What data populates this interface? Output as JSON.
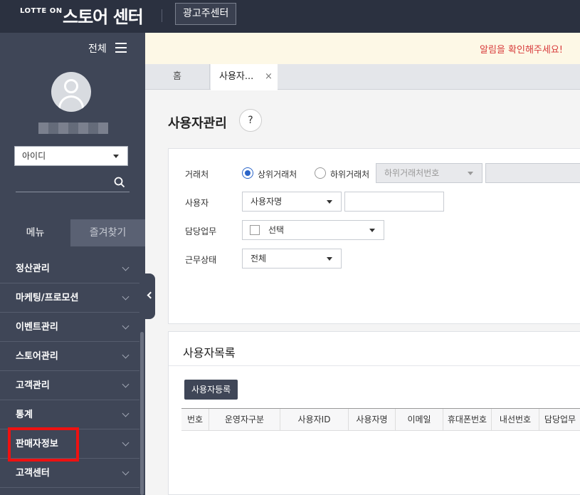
{
  "header": {
    "brand_small": "LOTTE ON",
    "brand_title": "스토어 센터",
    "ad_center_label": "광고주센터"
  },
  "sidebar": {
    "all_label": "전체",
    "id_select_value": "아이디",
    "tabs": {
      "menu": "메뉴",
      "favorites": "즐겨찾기"
    },
    "items": [
      {
        "label": "정산관리"
      },
      {
        "label": "마케팅/프로모션"
      },
      {
        "label": "이벤트관리"
      },
      {
        "label": "스토어관리"
      },
      {
        "label": "고객관리"
      },
      {
        "label": "통계"
      },
      {
        "label": "판매자정보"
      },
      {
        "label": "고객센터"
      }
    ],
    "highlight_color": "#ee1111"
  },
  "notice": {
    "text": "알림을 확인해주세요!"
  },
  "page_tabs": {
    "home": "홈",
    "current": "사용자...",
    "close": "×"
  },
  "page": {
    "title": "사용자관리",
    "help": "?"
  },
  "filters": {
    "partner_label": "거래처",
    "partner_upper": "상위거래처",
    "partner_lower": "하위거래처",
    "partner_lower_select": "하위거래처번호",
    "user_label": "사용자",
    "user_select": "사용자명",
    "duty_label": "담당업무",
    "duty_select": "선택",
    "status_label": "근무상태",
    "status_select": "전체"
  },
  "list": {
    "title": "사용자목록",
    "register_button": "사용자등록",
    "columns": [
      "번호",
      "운영자구분",
      "사용자ID",
      "사용자명",
      "이메일",
      "휴대폰번호",
      "내선번호",
      "담당업무"
    ]
  }
}
